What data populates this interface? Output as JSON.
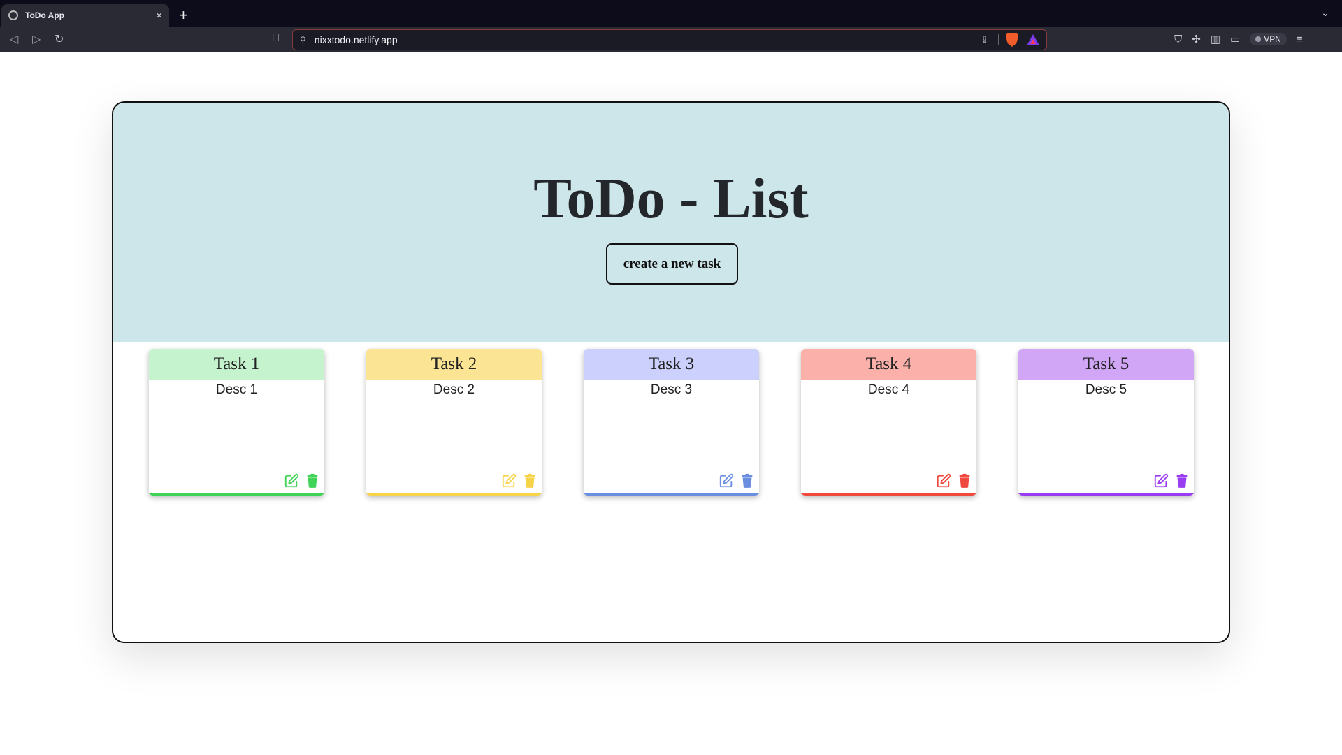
{
  "browser": {
    "tab_title": "ToDo App",
    "tab_close": "×",
    "new_tab": "+",
    "tab_menu": "⌄",
    "url": "nixxtodo.netlify.app",
    "vpn_label": "VPN"
  },
  "app": {
    "title": "ToDo - List",
    "create_button": "create a new task",
    "hero_bg": "#cde6ea"
  },
  "tasks": [
    {
      "title": "Task 1",
      "desc": "Desc 1",
      "head_color": "#c5f3cd",
      "accent": "#3fd455"
    },
    {
      "title": "Task 2",
      "desc": "Desc 2",
      "head_color": "#fbe594",
      "accent": "#f7d34a"
    },
    {
      "title": "Task 3",
      "desc": "Desc 3",
      "head_color": "#ccd0fc",
      "accent": "#6a8fe0"
    },
    {
      "title": "Task 4",
      "desc": "Desc 4",
      "head_color": "#fbb0aa",
      "accent": "#f04a3f"
    },
    {
      "title": "Task 5",
      "desc": "Desc 5",
      "head_color": "#d2a6f7",
      "accent": "#9a3cf0"
    }
  ],
  "icons": {
    "edit": "edit-icon",
    "delete": "trash-icon"
  }
}
